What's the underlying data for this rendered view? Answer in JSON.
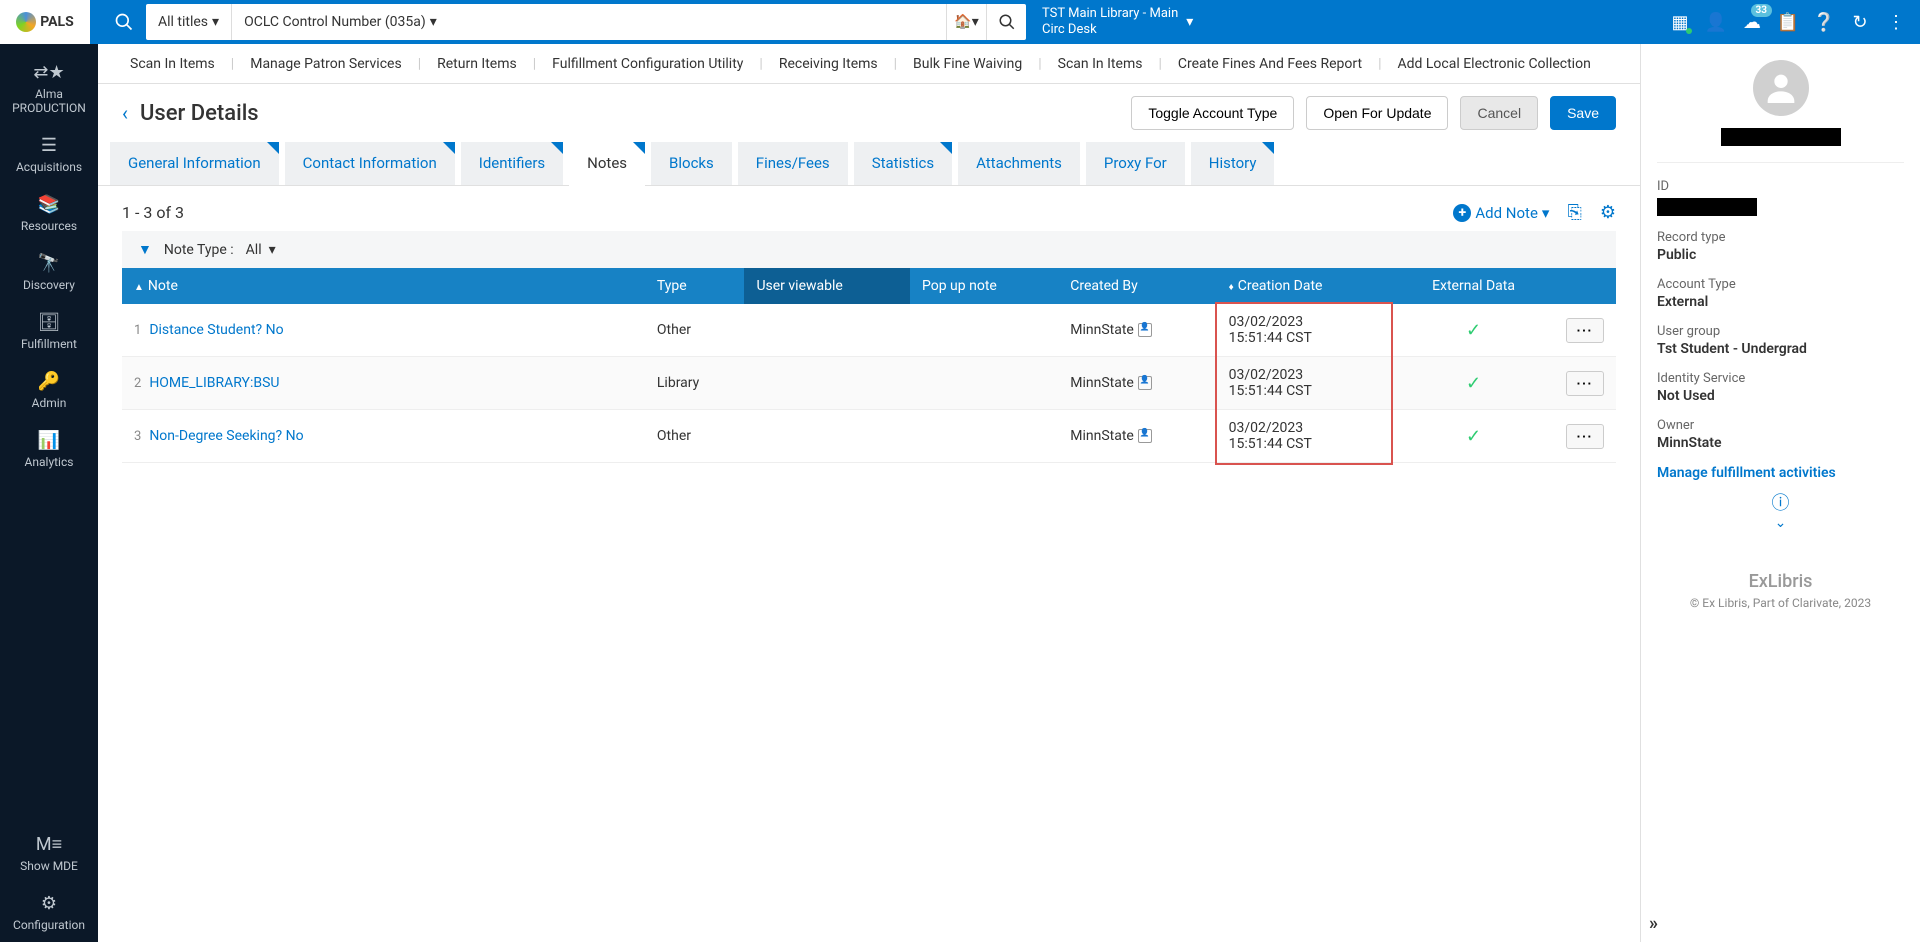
{
  "logo_text": "PALS",
  "search": {
    "scope": "All titles",
    "field": "OCLC Control Number (035a)"
  },
  "location": {
    "line1": "TST Main Library - Main",
    "line2": "Circ Desk"
  },
  "notification_badge": "33",
  "sidebar": [
    {
      "label": "Alma PRODUCTION",
      "icon": "⇄★"
    },
    {
      "label": "Acquisitions",
      "icon": "☰"
    },
    {
      "label": "Resources",
      "icon": "📚"
    },
    {
      "label": "Discovery",
      "icon": "🔭"
    },
    {
      "label": "Fulfillment",
      "icon": "🗄"
    },
    {
      "label": "Admin",
      "icon": "🔑"
    },
    {
      "label": "Analytics",
      "icon": "📊"
    },
    {
      "label": "Show MDE",
      "icon": "M≡"
    },
    {
      "label": "Configuration",
      "icon": "⚙"
    }
  ],
  "quick_links": [
    "Scan In Items",
    "Manage Patron Services",
    "Return Items",
    "Fulfillment Configuration Utility",
    "Receiving Items",
    "Bulk Fine Waiving",
    "Scan In Items",
    "Create Fines And Fees Report",
    "Add Local Electronic Collection"
  ],
  "page": {
    "title": "User Details",
    "btn_toggle": "Toggle Account Type",
    "btn_open": "Open For Update",
    "btn_cancel": "Cancel",
    "btn_save": "Save"
  },
  "tabs": [
    {
      "label": "General Information",
      "corner": true
    },
    {
      "label": "Contact Information",
      "corner": true
    },
    {
      "label": "Identifiers",
      "corner": true
    },
    {
      "label": "Notes",
      "corner": true,
      "active": true
    },
    {
      "label": "Blocks",
      "corner": false
    },
    {
      "label": "Fines/Fees",
      "corner": false
    },
    {
      "label": "Statistics",
      "corner": true
    },
    {
      "label": "Attachments",
      "corner": false
    },
    {
      "label": "Proxy For",
      "corner": false
    },
    {
      "label": "History",
      "corner": true
    }
  ],
  "table": {
    "count": "1 - 3 of 3",
    "add_note_label": "Add Note",
    "filter_label": "Note Type :",
    "filter_value": "All",
    "headers": {
      "note": "Note",
      "type": "Type",
      "user_viewable": "User viewable",
      "pop_up": "Pop up note",
      "created_by": "Created By",
      "creation_date": "Creation Date",
      "external_data": "External Data"
    },
    "rows": [
      {
        "num": "1",
        "note": "Distance Student? No",
        "type": "Other",
        "created_by": "MinnState",
        "date1": "03/02/2023",
        "date2": "15:51:44 CST"
      },
      {
        "num": "2",
        "note": "HOME_LIBRARY:BSU",
        "type": "Library",
        "created_by": "MinnState",
        "date1": "03/02/2023",
        "date2": "15:51:44 CST"
      },
      {
        "num": "3",
        "note": "Non-Degree Seeking? No",
        "type": "Other",
        "created_by": "MinnState",
        "date1": "03/02/2023",
        "date2": "15:51:44 CST"
      }
    ]
  },
  "right_panel": {
    "id_label": "ID",
    "record_type_label": "Record type",
    "record_type_value": "Public",
    "account_type_label": "Account Type",
    "account_type_value": "External",
    "user_group_label": "User group",
    "user_group_value": "Tst Student - Undergrad",
    "identity_label": "Identity Service",
    "identity_value": "Not Used",
    "owner_label": "Owner",
    "owner_value": "MinnState",
    "manage_link": "Manage fulfillment activities",
    "footer_brand": "ExLibris",
    "footer_text": "© Ex Libris, Part of Clarivate,   2023"
  }
}
